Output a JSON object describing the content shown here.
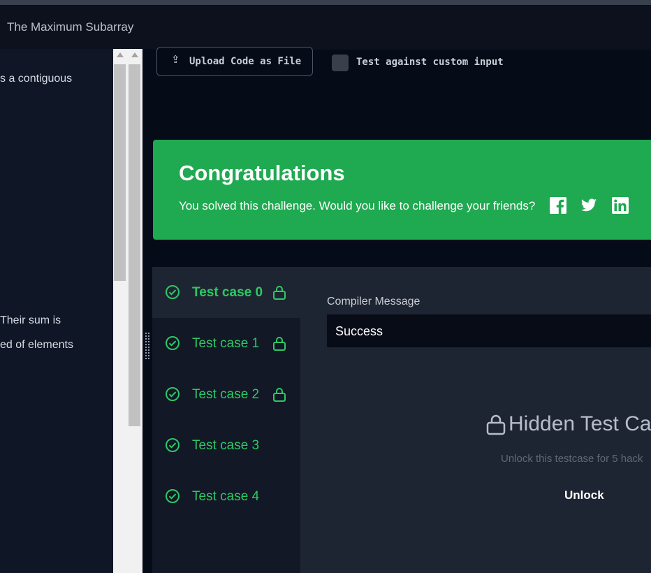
{
  "header": {
    "title": "The Maximum Subarray"
  },
  "problem": {
    "fragments": [
      "s a contiguous",
      "Their sum is",
      "ed of elements"
    ]
  },
  "toolbar": {
    "upload_label": "Upload Code as File",
    "custom_input_label": "Test against custom input",
    "custom_input_checked": false
  },
  "congrats": {
    "title": "Congratulations",
    "message": "You solved this challenge. Would you like to challenge your friends?",
    "share_icons": [
      "facebook-icon",
      "twitter-icon",
      "linkedin-icon"
    ]
  },
  "test_cases": [
    {
      "label": "Test case 0",
      "status": "passed",
      "locked": true,
      "active": true
    },
    {
      "label": "Test case 1",
      "status": "passed",
      "locked": true,
      "active": false
    },
    {
      "label": "Test case 2",
      "status": "passed",
      "locked": true,
      "active": false
    },
    {
      "label": "Test case 3",
      "status": "passed",
      "locked": false,
      "active": false
    },
    {
      "label": "Test case 4",
      "status": "passed",
      "locked": false,
      "active": false
    }
  ],
  "compiler": {
    "label": "Compiler Message",
    "value": "Success"
  },
  "hidden": {
    "title": "Hidden Test Ca",
    "subtitle": "Unlock this testcase for 5 hack",
    "unlock_label": "Unlock"
  },
  "colors": {
    "success_green": "#1fa950",
    "pass_green": "#2ec866",
    "background": "#060b18"
  }
}
